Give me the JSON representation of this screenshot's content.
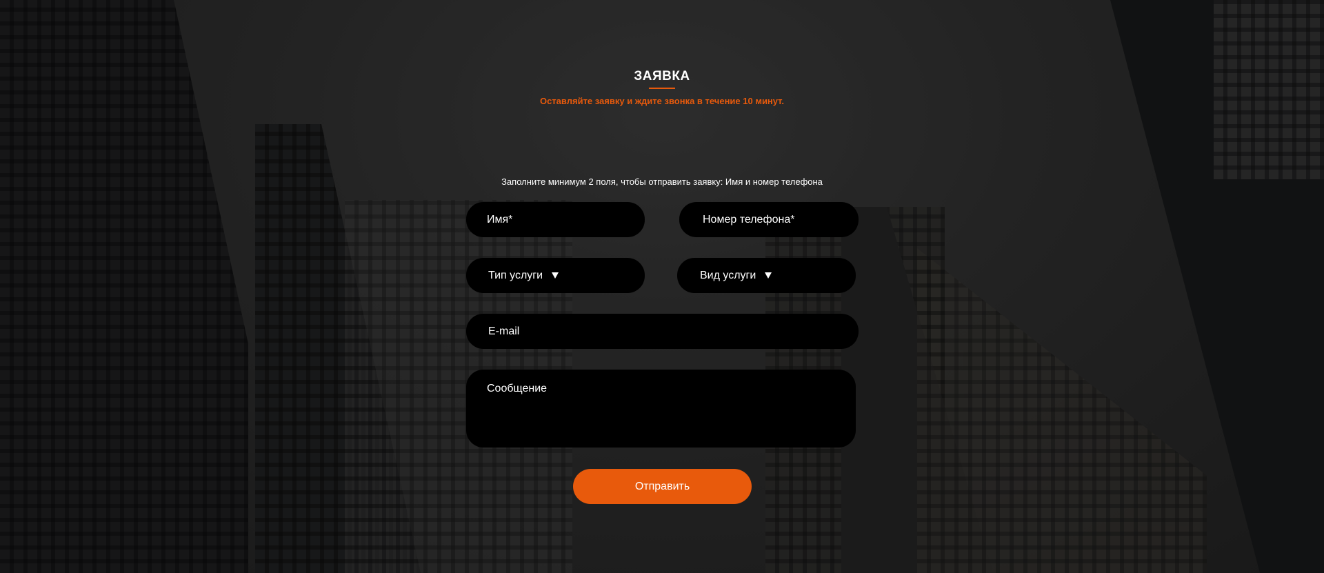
{
  "header": {
    "title": "ЗАЯВКА",
    "subtitle": "Оставляйте заявку и ждите звонка в течение 10 минут."
  },
  "form": {
    "hint": "Заполните минимум 2 поля, чтобы отправить заявку: Имя и номер телефона",
    "name_placeholder": "Имя*",
    "phone_placeholder": "Номер телефона*",
    "service_type_label": "Тип услуги",
    "service_kind_label": "Вид услуги",
    "email_placeholder": "E-mail",
    "message_placeholder": "Сообщение",
    "submit_label": "Отправить"
  },
  "colors": {
    "accent": "#e85a0c",
    "field_background": "#000000",
    "text": "#ffffff"
  }
}
